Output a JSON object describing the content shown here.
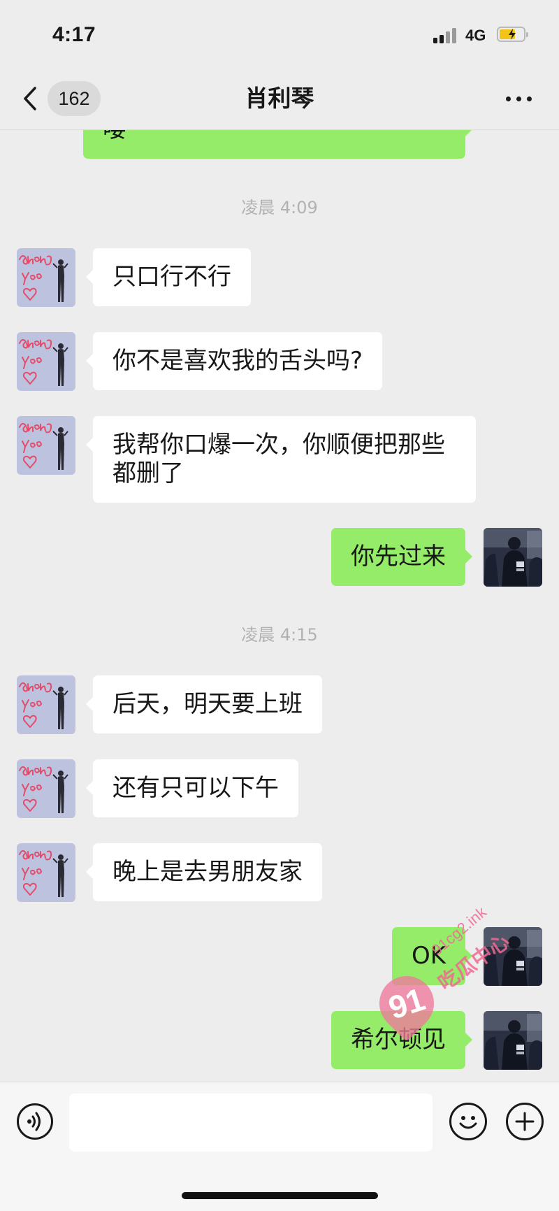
{
  "status_bar": {
    "time": "4:17",
    "network": "4G",
    "icons": [
      "signal-icon",
      "battery-charging-icon"
    ]
  },
  "nav": {
    "unread_count": "162",
    "title": "肖利琴",
    "icons": [
      "chevron-left-icon",
      "more-icon"
    ]
  },
  "messages": [
    {
      "type": "message",
      "side": "right",
      "text": "喽"
    },
    {
      "type": "time",
      "text": "凌晨 4:09"
    },
    {
      "type": "message",
      "side": "left",
      "text": "只口行不行"
    },
    {
      "type": "message",
      "side": "left",
      "text": "你不是喜欢我的舌头吗?"
    },
    {
      "type": "message",
      "side": "left",
      "text": "我帮你口爆一次，你顺便把那些都删了"
    },
    {
      "type": "message",
      "side": "right",
      "text": "你先过来"
    },
    {
      "type": "time",
      "text": "凌晨 4:15"
    },
    {
      "type": "message",
      "side": "left",
      "text": "后天，明天要上班"
    },
    {
      "type": "message",
      "side": "left",
      "text": "还有只可以下午"
    },
    {
      "type": "message",
      "side": "left",
      "text": "晚上是去男朋友家"
    },
    {
      "type": "message",
      "side": "right",
      "text": "OK"
    },
    {
      "type": "message",
      "side": "right",
      "text": "希尔顿见"
    }
  ],
  "input_bar": {
    "value": "",
    "icons": [
      "voice-icon",
      "emoji-icon",
      "plus-icon"
    ]
  },
  "watermark": {
    "badge": "91",
    "domain": "91cg2.ink",
    "name": "吃瓜中心"
  },
  "colors": {
    "background": "#ededed",
    "sent_bubble": "#95ec69",
    "received_bubble": "#ffffff",
    "timestamp": "#b2b2b2"
  }
}
